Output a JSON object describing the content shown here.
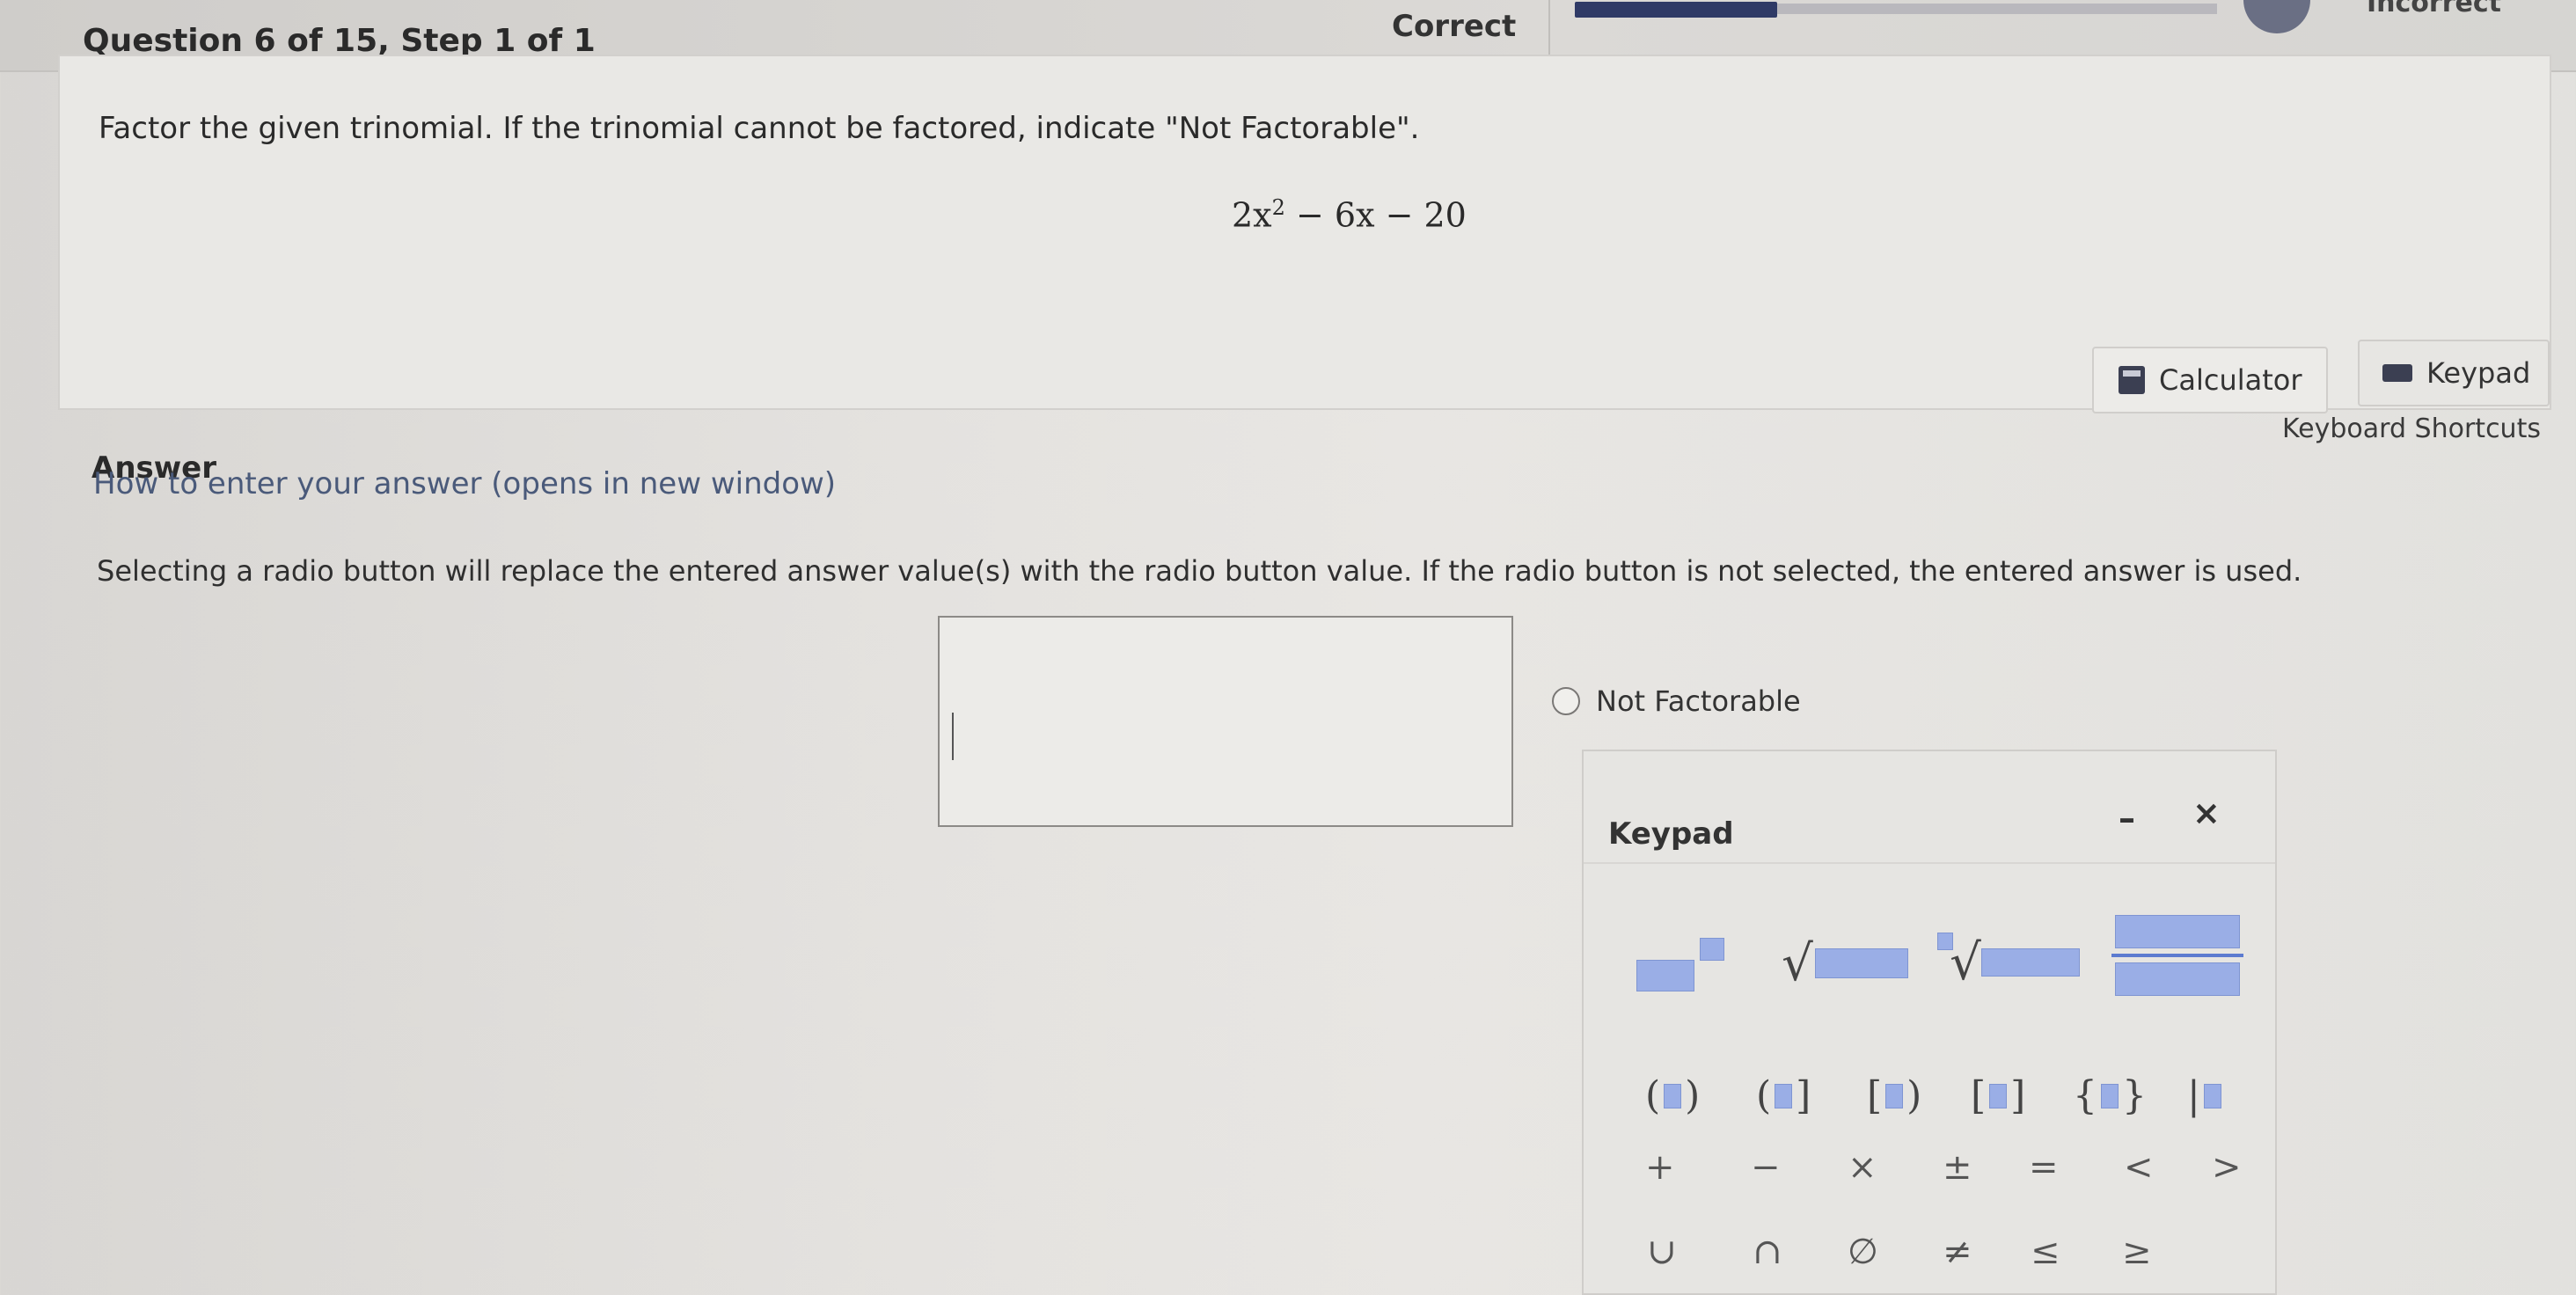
{
  "header": {
    "question": "Question 6 of 15,  Step 1 of 1",
    "status": "Correct",
    "status_next": "Incorrect"
  },
  "question": {
    "prompt": "Factor the given trinomial. If the trinomial cannot be factored, indicate \"Not Factorable\".",
    "expression_base": "2x",
    "expression_exp": "2",
    "expression_rest": " − 6x − 20"
  },
  "tools": {
    "calculator_label": "Calculator",
    "keypad_label": "Keypad",
    "shortcuts_label": "Keyboard Shortcuts"
  },
  "answer": {
    "label": "Answer",
    "howto_link": "How to enter your answer (opens in new window)",
    "instructions": "Selecting a radio button will replace the entered answer value(s) with the radio button value. If the radio button is not selected, the entered answer is used.",
    "input_value": "",
    "radio_label": "Not Factorable"
  },
  "keypad": {
    "title": "Keypad",
    "minimize": "–",
    "close": "×",
    "sqrt_symbol": "√",
    "brackets": [
      {
        "open": "(",
        "close": ")"
      },
      {
        "open": "(",
        "close": "]"
      },
      {
        "open": "[",
        "close": ")"
      },
      {
        "open": "[",
        "close": "]"
      },
      {
        "open": "{",
        "close": "}"
      },
      {
        "open": "|",
        "close": ""
      }
    ],
    "operators": [
      "+",
      "−",
      "×",
      "±",
      "=",
      "<",
      ">"
    ],
    "set_symbols": [
      "∪",
      "∩",
      "∅",
      "≠",
      "≤",
      "≥"
    ]
  },
  "colors": {
    "placeholder": "#9aaee6",
    "progress": "#2f3a66"
  }
}
